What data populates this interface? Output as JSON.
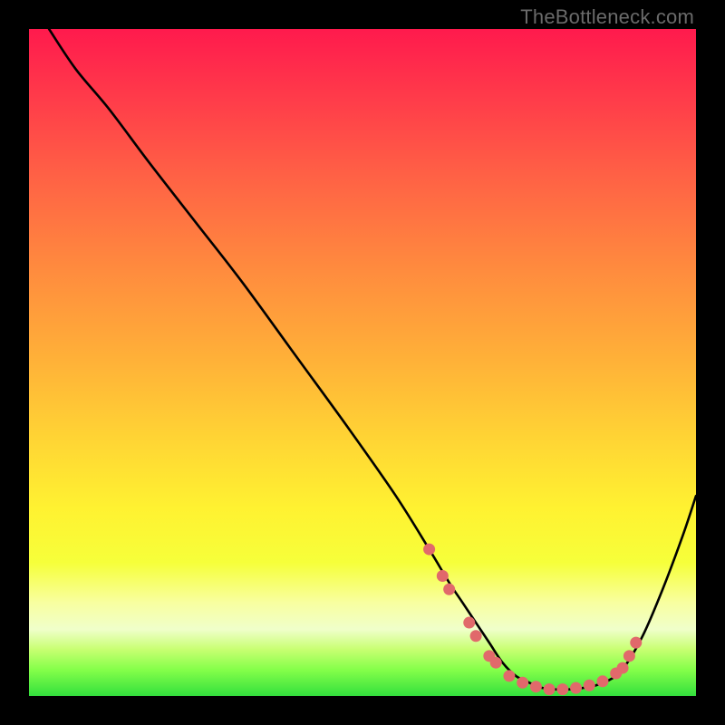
{
  "watermark": "TheBottleneck.com",
  "colors": {
    "curve": "#000000",
    "dots": "#e1696b",
    "gradient_top": "#ff1a4d",
    "gradient_bottom": "#33e03d",
    "frame": "#000000"
  },
  "chart_data": {
    "type": "line",
    "title": "",
    "xlabel": "",
    "ylabel": "",
    "xlim": [
      0,
      100
    ],
    "ylim": [
      0,
      100
    ],
    "grid": false,
    "legend": false,
    "series": [
      {
        "name": "curve",
        "x": [
          3,
          7,
          12,
          18,
          25,
          32,
          40,
          48,
          55,
          60,
          63,
          65,
          67,
          69,
          71,
          73,
          75,
          77,
          79,
          81,
          83,
          85,
          87,
          89,
          92,
          95,
          98,
          100
        ],
        "y": [
          100,
          94,
          88,
          80,
          71,
          62,
          51,
          40,
          30,
          22,
          17,
          14,
          11,
          8,
          5,
          3,
          2,
          1.2,
          1,
          1,
          1.2,
          1.6,
          2.4,
          4,
          9,
          16,
          24,
          30
        ]
      }
    ],
    "markers": [
      {
        "x": 60,
        "y": 22
      },
      {
        "x": 62,
        "y": 18
      },
      {
        "x": 63,
        "y": 16
      },
      {
        "x": 66,
        "y": 11
      },
      {
        "x": 67,
        "y": 9
      },
      {
        "x": 69,
        "y": 6
      },
      {
        "x": 70,
        "y": 5
      },
      {
        "x": 72,
        "y": 3
      },
      {
        "x": 74,
        "y": 2
      },
      {
        "x": 76,
        "y": 1.4
      },
      {
        "x": 78,
        "y": 1
      },
      {
        "x": 80,
        "y": 1
      },
      {
        "x": 82,
        "y": 1.2
      },
      {
        "x": 84,
        "y": 1.6
      },
      {
        "x": 86,
        "y": 2.2
      },
      {
        "x": 88,
        "y": 3.4
      },
      {
        "x": 89,
        "y": 4.2
      },
      {
        "x": 90,
        "y": 6
      },
      {
        "x": 91,
        "y": 8
      }
    ]
  }
}
